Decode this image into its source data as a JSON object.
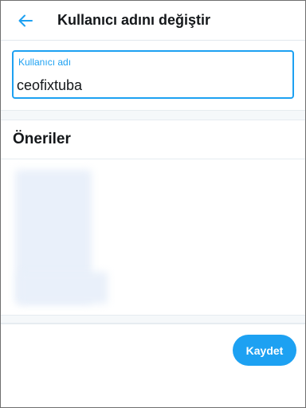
{
  "header": {
    "back_icon": "arrow-left-icon",
    "title": "Kullanıcı adını değiştir"
  },
  "username_field": {
    "label": "Kullanıcı adı",
    "value": "ceofixtuba"
  },
  "suggestions": {
    "title": "Öneriler"
  },
  "footer": {
    "save_label": "Kaydet"
  },
  "colors": {
    "accent": "#1da1f2",
    "text": "#14171a",
    "divider": "#e6ecf0",
    "band": "#f5f8fa"
  }
}
